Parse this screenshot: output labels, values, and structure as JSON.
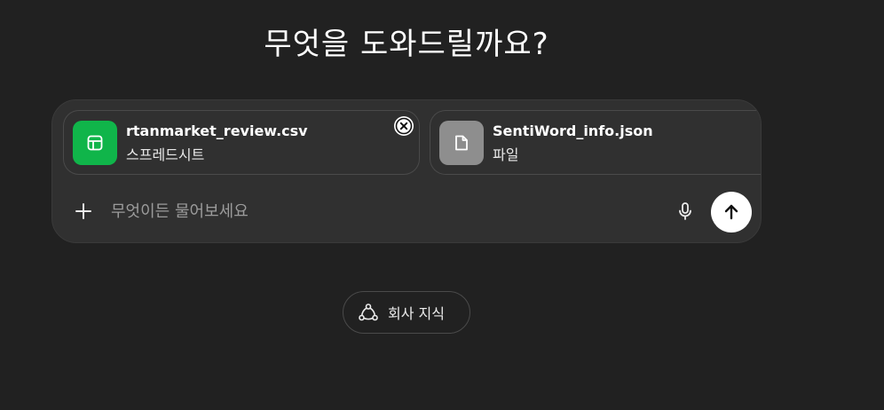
{
  "heading": "무엇을 도와드릴까요?",
  "attachments": [
    {
      "name": "rtanmarket_review.csv",
      "type": "스프레드시트",
      "icon": "spreadsheet-icon",
      "color": "#10b54a"
    },
    {
      "name": "SentiWord_info.json",
      "type": "파일",
      "icon": "document-icon",
      "color": "#8e8e8e"
    }
  ],
  "composer": {
    "placeholder": "무엇이든 물어보세요",
    "value": ""
  },
  "chip": {
    "label": "회사 지식",
    "icon": "company-knowledge-icon"
  },
  "colors": {
    "background": "#212121",
    "composer": "#303030",
    "accent_green": "#10b54a"
  }
}
